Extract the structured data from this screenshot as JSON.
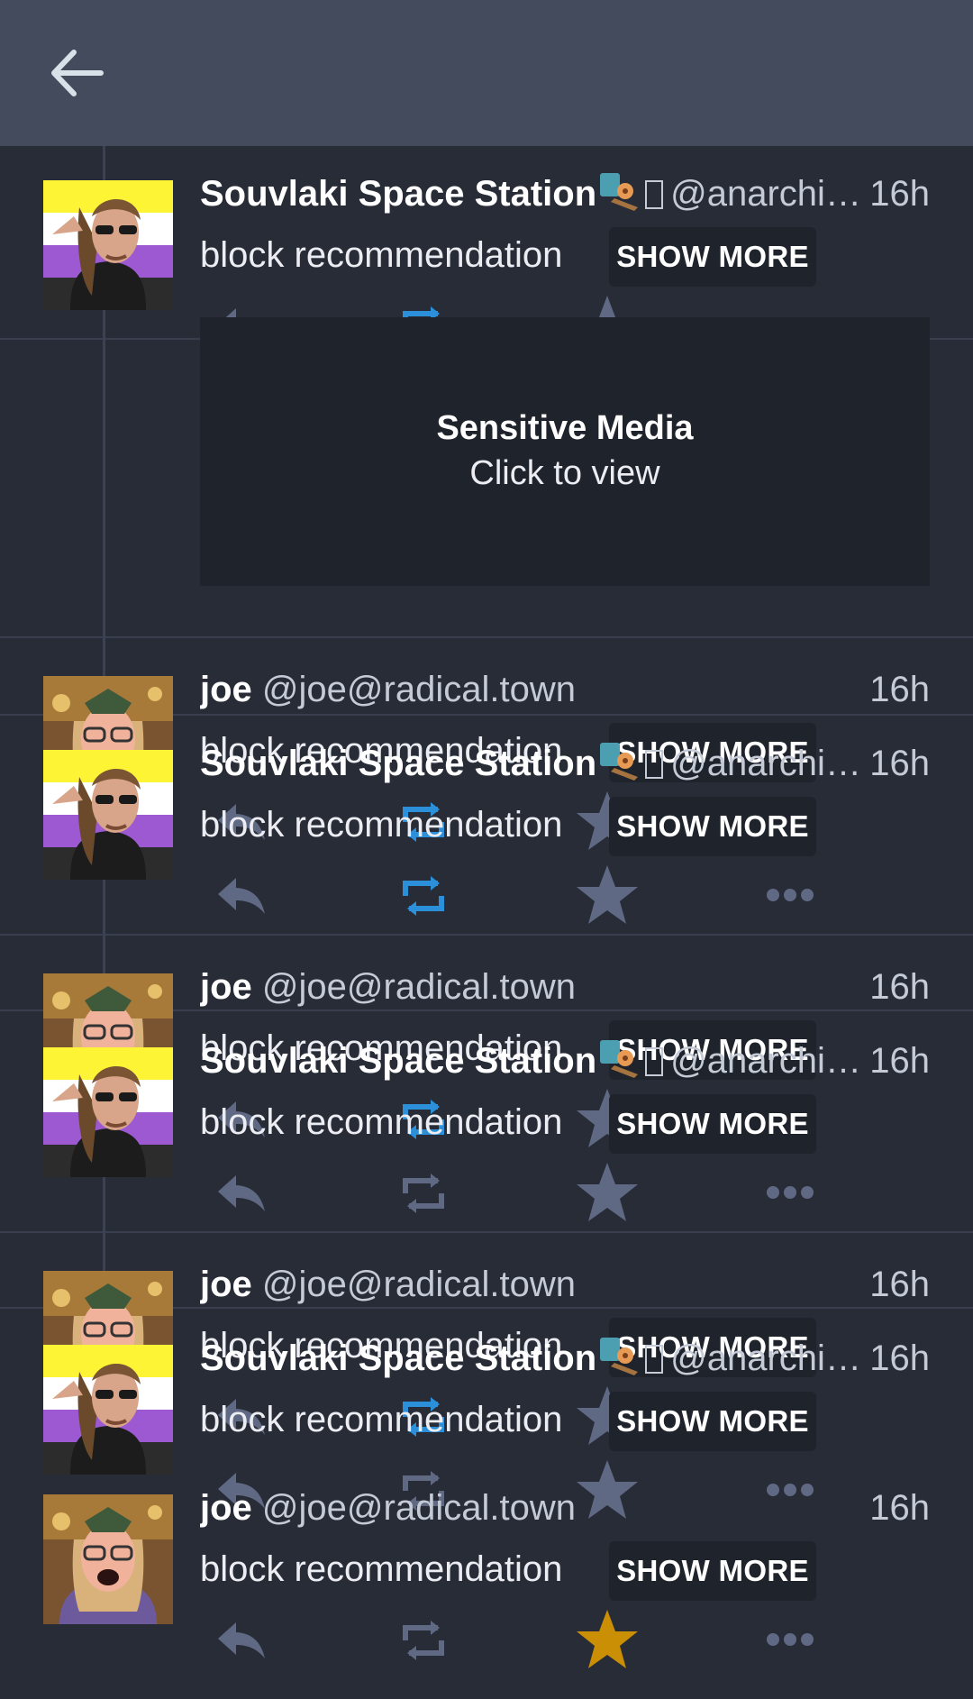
{
  "appbar": {
    "back_icon": "arrow-left-icon"
  },
  "colors": {
    "background": "#282c37",
    "appbar": "#444b5d",
    "boost": "#2b90d9",
    "fav_active": "#ca8f04",
    "icon_muted": "#606984"
  },
  "statuses": [
    {
      "display_name": "Souvlaki Space Station",
      "acct": "@anarchi…",
      "time": "16h",
      "content": "block recommendation",
      "show_more": "SHOW MORE",
      "avatar": "souvlaki",
      "boosted": true,
      "favourited": false
    },
    {
      "display_name": "joe",
      "acct": "@joe@radical.town",
      "time": "16h",
      "content": "block recommendation",
      "show_more": "SHOW MORE",
      "avatar": "joe",
      "boosted": true,
      "favourited": false
    },
    {
      "display_name": "Souvlaki Space Station",
      "acct": "@anarchi…",
      "time": "16h",
      "content": "block recommendation",
      "show_more": "SHOW MORE",
      "avatar": "souvlaki",
      "boosted": true,
      "favourited": false
    },
    {
      "display_name": "joe",
      "acct": "@joe@radical.town",
      "time": "16h",
      "content": "block recommendation",
      "show_more": "SHOW MORE",
      "avatar": "joe",
      "boosted": true,
      "favourited": false
    },
    {
      "display_name": "Souvlaki Space Station",
      "acct": "@anarchi…",
      "time": "16h",
      "content": "block recommendation",
      "show_more": "SHOW MORE",
      "avatar": "souvlaki",
      "boosted": false,
      "favourited": false
    },
    {
      "display_name": "joe",
      "acct": "@joe@radical.town",
      "time": "16h",
      "content": "block recommendation",
      "show_more": "SHOW MORE",
      "avatar": "joe",
      "boosted": true,
      "favourited": false
    },
    {
      "display_name": "Souvlaki Space Station",
      "acct": "@anarchi…",
      "time": "16h",
      "content": "block recommendation",
      "show_more": "SHOW MORE",
      "avatar": "souvlaki",
      "boosted": false,
      "favourited": false
    },
    {
      "display_name": "joe",
      "acct": "@joe@radical.town",
      "time": "16h",
      "content": "block recommendation",
      "show_more": "SHOW MORE",
      "avatar": "joe",
      "boosted": false,
      "favourited": true
    }
  ],
  "sensitive_media": {
    "title": "Sensitive Media",
    "subtitle": "Click to view"
  }
}
